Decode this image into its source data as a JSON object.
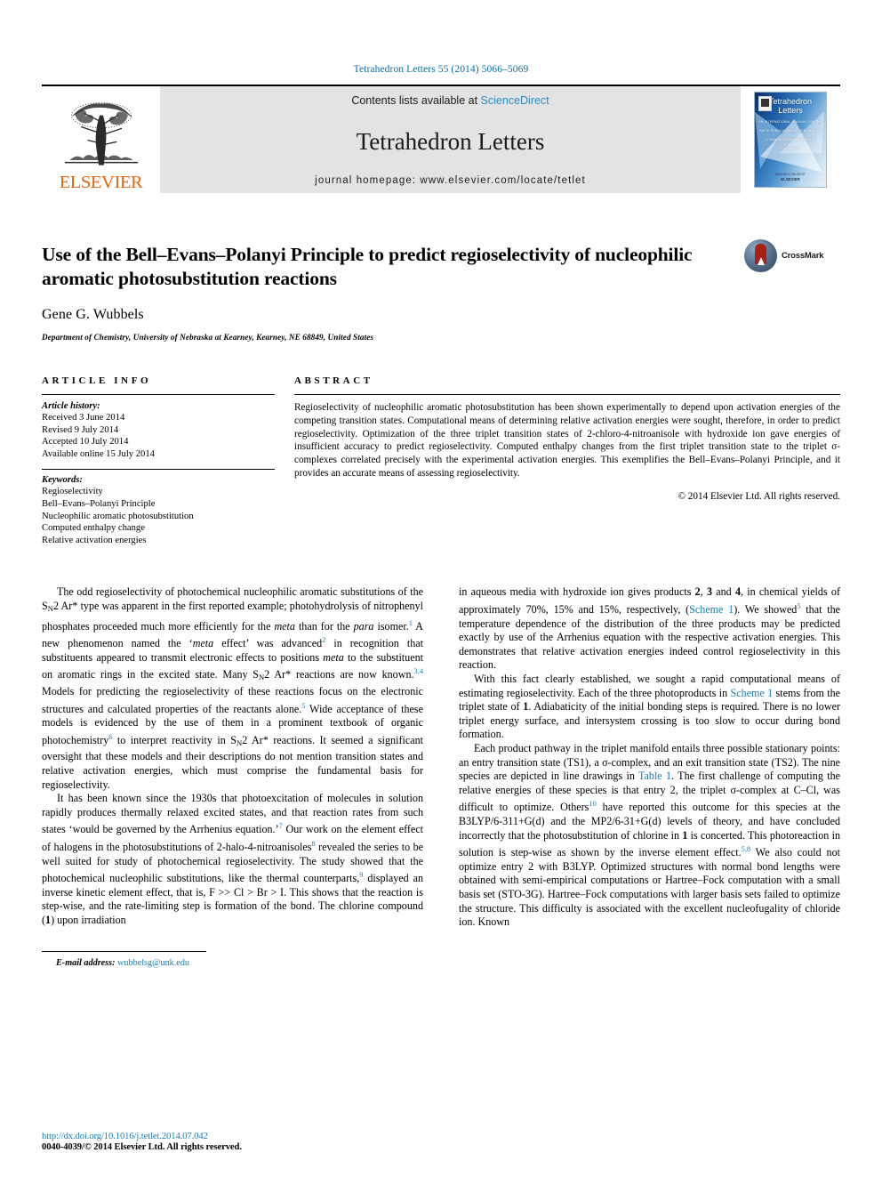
{
  "running_head": "Tetrahedron Letters 55 (2014) 5066–5069",
  "masthead": {
    "publisher_name": "ELSEVIER",
    "contents_prefix": "Contents lists available at",
    "sciencedirect": "ScienceDirect",
    "journal_title": "Tetrahedron Letters",
    "homepage": "journal homepage: www.elsevier.com/locate/tetlet",
    "cover": {
      "line1": "Tetrahedron",
      "line2": "Letters",
      "subtitle": "AN INTERNATIONAL JOURNAL FOR THE RAPID PUBLICATION OF PRELIMINARY COMMUNICATIONS IN ORGANIC CHEMISTRY",
      "footer_small": "AVAILABLE ONLINE AT",
      "footer_brand": "ELSEVIER"
    }
  },
  "article": {
    "title": "Use of the Bell–Evans–Polanyi Principle to predict regioselectivity of nucleophilic aromatic photosubstitution reactions",
    "authors": "Gene G. Wubbels",
    "affiliation": "Department of Chemistry, University of Nebraska at Kearney, Kearney, NE 68849, United States",
    "crossmark_label": "CrossMark"
  },
  "info": {
    "heading": "ARTICLE INFO",
    "history_label": "Article history:",
    "history": [
      "Received 3 June 2014",
      "Revised 9 July 2014",
      "Accepted 10 July 2014",
      "Available online 15 July 2014"
    ],
    "keywords_label": "Keywords:",
    "keywords": [
      "Regioselectivity",
      "Bell–Evans–Polanyi Principle",
      "Nucleophilic aromatic photosubstitution",
      "Computed enthalpy change",
      "Relative activation energies"
    ]
  },
  "abstract": {
    "heading": "ABSTRACT",
    "text": "Regioselectivity of nucleophilic aromatic photosubstitution has been shown experimentally to depend upon activation energies of the competing transition states. Computational means of determining relative activation energies were sought, therefore, in order to predict regioselectivity. Optimization of the three triplet transition states of 2-chloro-4-nitroanisole with hydroxide ion gave energies of insufficient accuracy to predict regioselectivity. Computed enthalpy changes from the first triplet transition state to the triplet σ-complexes correlated precisely with the experimental activation energies. This exemplifies the Bell–Evans–Polanyi Principle, and it provides an accurate means of assessing regioselectivity.",
    "copyright": "© 2014 Elsevier Ltd. All rights reserved."
  },
  "body": {
    "left": {
      "p1_a": "The odd regioselectivity of photochemical nucleophilic aromatic substitutions of the S",
      "p1_sub1": "N",
      "p1_b": "2 Ar* type was apparent in the first reported example; photohydrolysis of nitrophenyl phosphates proceeded much more efficiently for the ",
      "p1_meta1": "meta",
      "p1_c": " than for the ",
      "p1_para1": "para",
      "p1_d": " isomer.",
      "p1_ref1": "1",
      "p1_e": " A new phenomenon named the ‘",
      "p1_meta2": "meta",
      "p1_f": " effect’ was advanced",
      "p1_ref2": "2",
      "p1_g": " in recognition that substituents appeared to transmit electronic effects to positions ",
      "p1_meta3": "meta",
      "p1_h": " to the substituent on aromatic rings in the excited state. Many S",
      "p1_sub2": "N",
      "p1_i": "2 Ar* reactions are now known.",
      "p1_ref3": "3,4",
      "p1_j": " Models for predicting the regioselectivity of these reactions focus on the electronic structures and calculated properties of the reactants alone.",
      "p1_ref4": "5",
      "p1_k": " Wide acceptance of these models is evidenced by the use of them in a prominent textbook of organic photochemistry",
      "p1_ref5": "6",
      "p1_l": " to interpret reactivity in S",
      "p1_sub3": "N",
      "p1_m": "2 Ar* reactions. It seemed a significant oversight that these models and their descriptions do not mention transition states and relative activation energies, which must comprise the fundamental basis for regioselectivity.",
      "p2_a": "It has been known since the 1930s that photoexcitation of molecules in solution rapidly produces thermally relaxed excited states, and that reaction rates from such states ‘would be governed by the Arrhenius equation.’",
      "p2_ref1": "7",
      "p2_b": " Our work on the element effect of halogens in the photosubstitutions of 2-halo-4-nitroanisoles",
      "p2_ref2": "8",
      "p2_c": " revealed the series to be well suited for study of photochemical regioselectivity. The study showed that the photochemical nucleophilic substitutions, like the thermal counterparts,",
      "p2_ref3": "9",
      "p2_d": " displayed an inverse kinetic element effect, that is, F >> Cl > Br > I. This shows that the reaction is step-wise, and the rate-limiting step is formation of the bond. The chlorine compound (",
      "p2_bold1": "1",
      "p2_e": ") upon irradiation"
    },
    "right": {
      "p3_a": "in aqueous media with hydroxide ion gives products ",
      "p3_b2": "2",
      "p3_c": ", ",
      "p3_b3": "3",
      "p3_d": " and ",
      "p3_b4": "4",
      "p3_e": ", in chemical yields of approximately 70%, 15% and 15%, respectively, (",
      "p3_link1": "Scheme 1",
      "p3_f": "). We showed",
      "p3_ref1": "5",
      "p3_g": " that the temperature dependence of the distribution of the three products may be predicted exactly by use of the Arrhenius equation with the respective activation energies. This demonstrates that relative activation energies indeed control regioselectivity in this reaction.",
      "p4_a": "With this fact clearly established, we sought a rapid computational means of estimating regioselectivity. Each of the three photoproducts in ",
      "p4_link1": "Scheme 1",
      "p4_b": " stems from the triplet state of ",
      "p4_bold1": "1",
      "p4_c": ". Adiabaticity of the initial bonding steps is required. There is no lower triplet energy surface, and intersystem crossing is too slow to occur during bond formation.",
      "p5_a": "Each product pathway in the triplet manifold entails three possible stationary points: an entry transition state (TS1), a σ-complex, and an exit transition state (TS2). The nine species are depicted in line drawings in ",
      "p5_link1": "Table 1",
      "p5_b": ". The first challenge of computing the relative energies of these species is that entry 2, the triplet σ-complex at C–Cl, was difficult to optimize. Others",
      "p5_ref1": "10",
      "p5_c": " have reported this outcome for this species at the B3LYP/6-311+G(d) and the MP2/6-31+G(d) levels of theory, and have concluded incorrectly that the photosubstitution of chlorine in ",
      "p5_bold1": "1",
      "p5_d": " is concerted. This photoreaction in solution is step-wise as shown by the inverse element effect.",
      "p5_ref2": "5,8",
      "p5_e": " We also could not optimize entry 2 with B3LYP. Optimized structures with normal bond lengths were obtained with semi-empirical computations or Hartree–Fock computation with a small basis set (STO-3G). Hartree–Fock computations with larger basis sets failed to optimize the structure. This difficulty is associated with the excellent nucleofugality of chloride ion. Known"
    }
  },
  "footnote": {
    "label": "E-mail address:",
    "email": "wubbelsg@unk.edu"
  },
  "footer": {
    "doi": "http://dx.doi.org/10.1016/j.tetlet.2014.07.042",
    "issn_copyright": "0040-4039/© 2014 Elsevier Ltd. All rights reserved."
  },
  "colors": {
    "link": "#1a7eb0",
    "elsevier_orange": "#e8650d",
    "banner_gray": "#e3e3e3"
  }
}
